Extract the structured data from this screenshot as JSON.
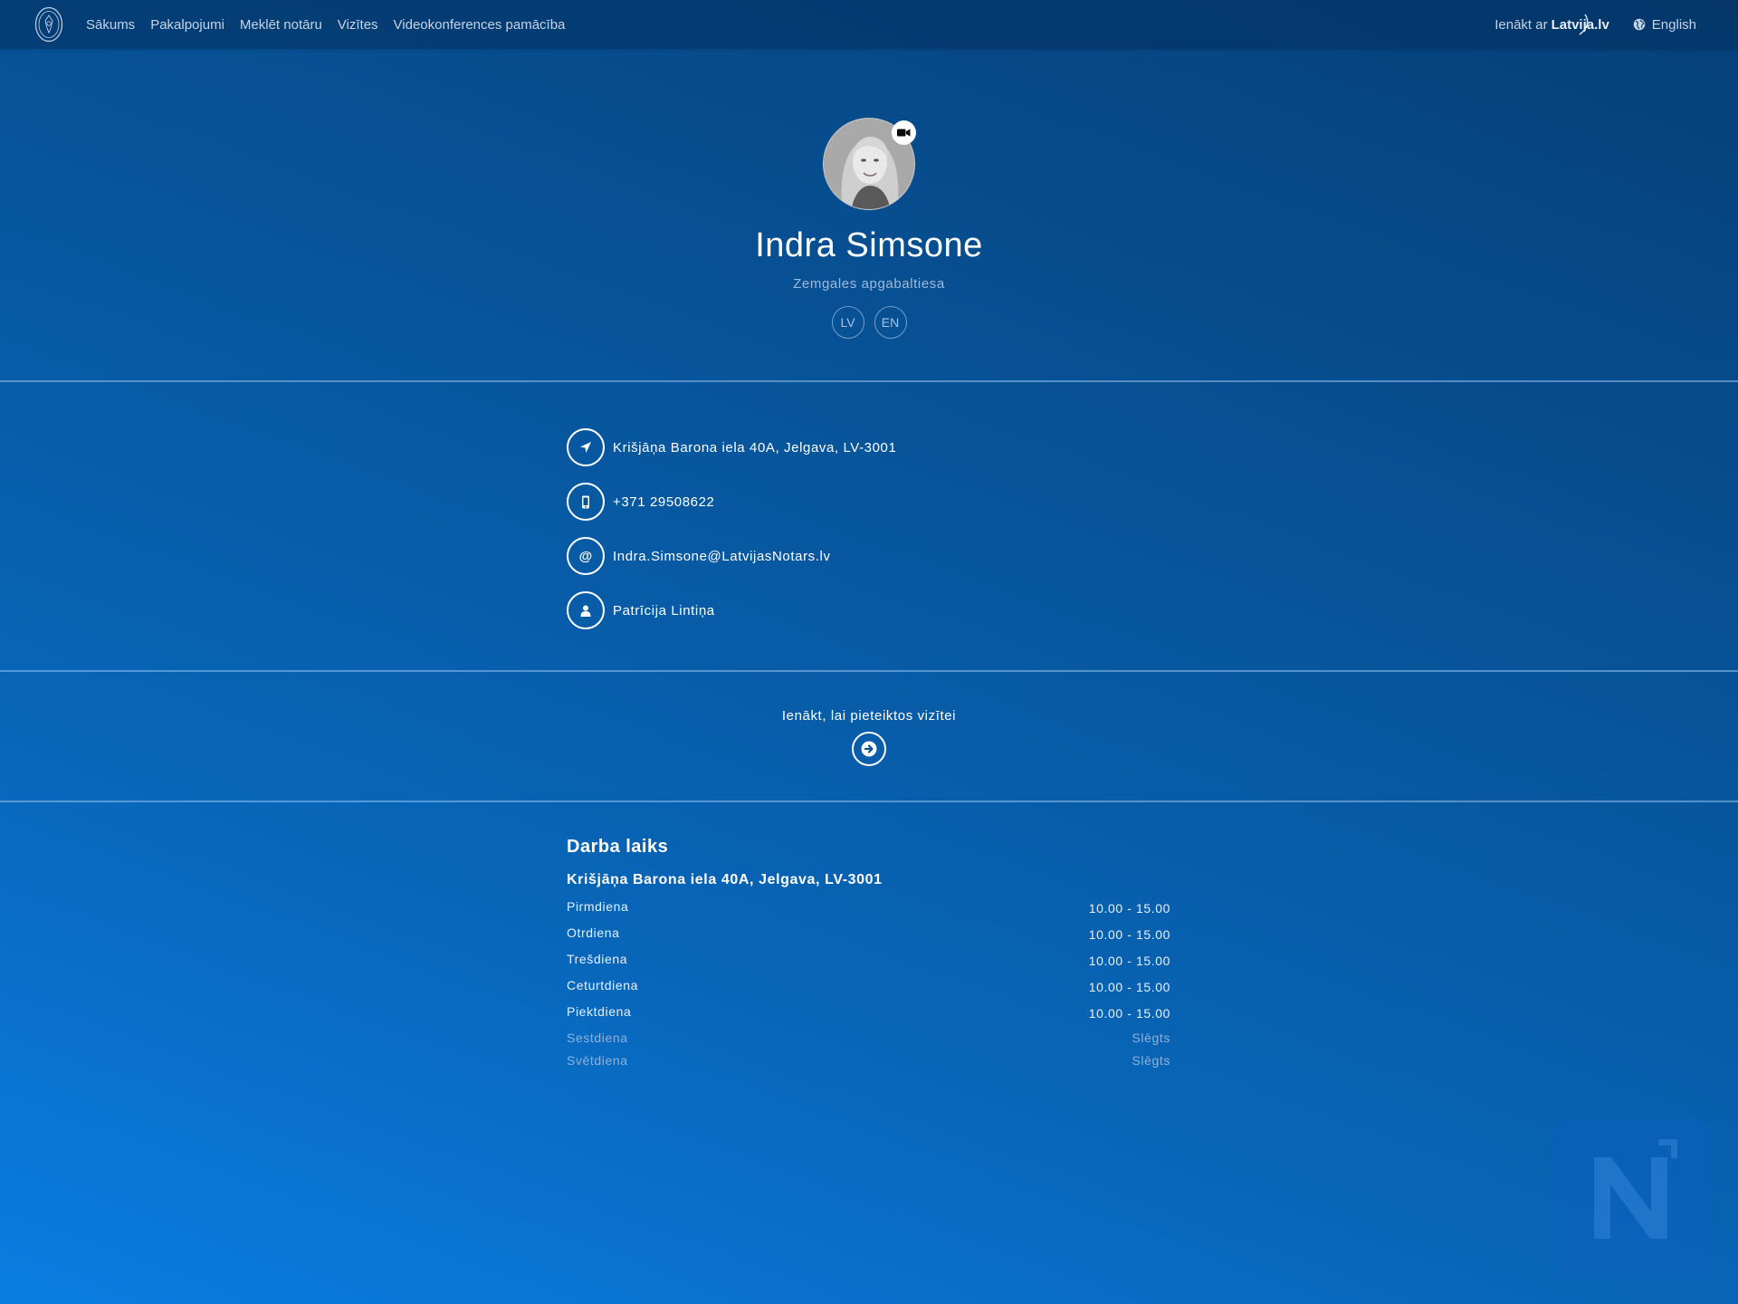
{
  "nav": {
    "items": [
      "Sākums",
      "Pakalpojumi",
      "Meklēt notāru",
      "Vizītes",
      "Videokonferences pamācība"
    ],
    "login_prefix": "Ienākt ar",
    "login_brand": "Latvija.lv",
    "language": "English"
  },
  "profile": {
    "name": "Indra Simsone",
    "court": "Zemgales apgabaltiesa",
    "languages": [
      "LV",
      "EN"
    ]
  },
  "contacts": {
    "address": "Krišjāņa Barona iela 40A, Jelgava, LV-3001",
    "phone": "+371 29508622",
    "email": "Indra.Simsone@LatvijasNotars.lv",
    "assistant": "Patrīcija Lintiņa"
  },
  "cta": {
    "text": "Ienākt, lai pieteiktos vizītei"
  },
  "hours": {
    "title": "Darba laiks",
    "address": "Krišjāņa Barona iela 40A, Jelgava, LV-3001",
    "days": [
      {
        "day": "Pirmdiena",
        "time": "10.00 - 15.00"
      },
      {
        "day": "Otrdiena",
        "time": "10.00 - 15.00"
      },
      {
        "day": "Trešdiena",
        "time": "10.00 - 15.00"
      },
      {
        "day": "Ceturtdiena",
        "time": "10.00 - 15.00"
      },
      {
        "day": "Piektdiena",
        "time": "10.00 - 15.00"
      },
      {
        "day": "Sestdiena",
        "time": "Slēgts"
      },
      {
        "day": "Svētdiena",
        "time": "Slēgts"
      }
    ]
  },
  "icons": {
    "logo": "notary-seal-logo",
    "language": "globe-icon",
    "video": "video-camera-icon",
    "address": "location-arrow-icon",
    "phone": "mobile-phone-icon",
    "email": "at-sign-icon",
    "assistant": "user-icon",
    "cta": "arrow-right-icon",
    "watermark": "notary-n-logo"
  },
  "colors": {
    "background_top": "#063f78",
    "background_bottom": "#0b7de2",
    "nav_text": "#c4d4e6",
    "muted_text": "#9fbbdc"
  }
}
